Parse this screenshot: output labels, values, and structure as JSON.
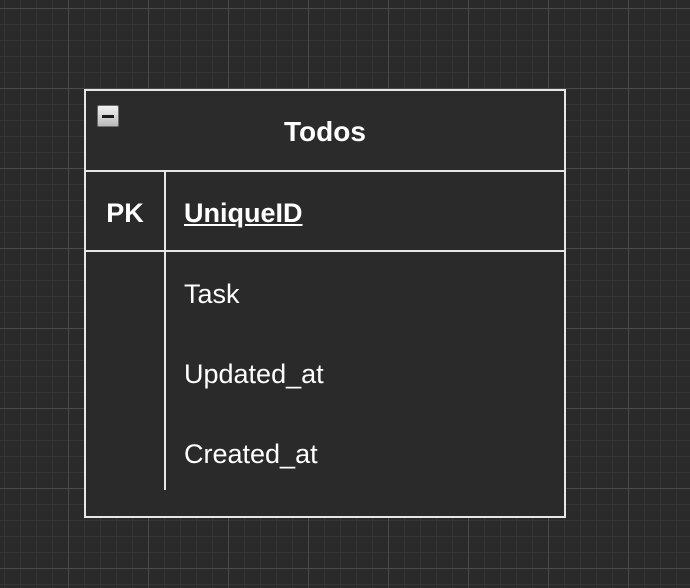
{
  "entity": {
    "title": "Todos",
    "primary_key": {
      "label": "PK",
      "field": "UniqueID"
    },
    "fields": [
      "Task",
      "Updated_at",
      "Created_at"
    ]
  },
  "icons": {
    "collapse": "collapse-minus-icon"
  },
  "colors": {
    "background": "#2a2a2a",
    "border": "#e6e6e6",
    "text": "#ffffff"
  }
}
